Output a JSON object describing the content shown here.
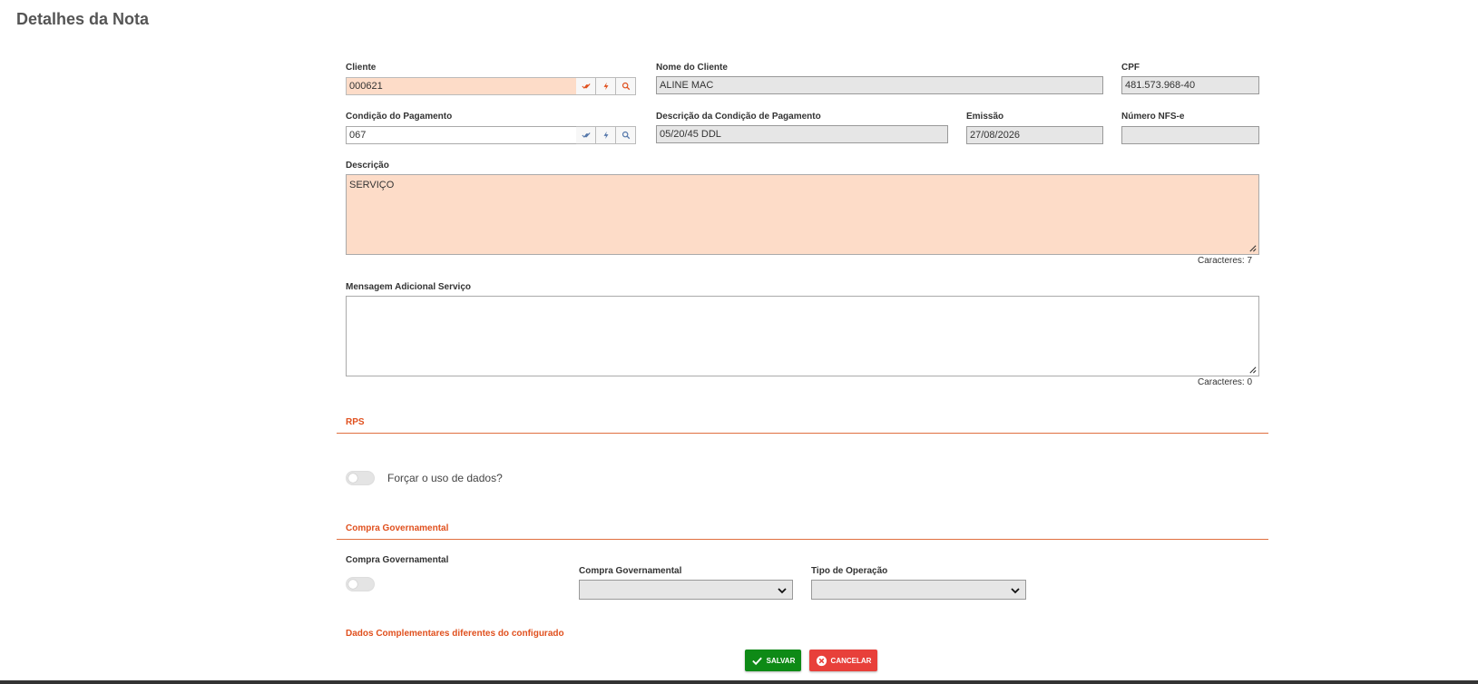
{
  "page": {
    "title": "Detalhes da Nota"
  },
  "cliente": {
    "label": "Cliente",
    "value": "000621",
    "icons": [
      "check-all-icon",
      "lightning-icon",
      "search-icon"
    ]
  },
  "nome_cliente": {
    "label": "Nome do Cliente",
    "value": "ALINE MAC"
  },
  "cpf": {
    "label": "CPF",
    "value": "481.573.968-40"
  },
  "condicao": {
    "label": "Condição do Pagamento",
    "value": "067"
  },
  "descricao_condicao": {
    "label": "Descrição da Condição de Pagamento",
    "value": "05/20/45 DDL"
  },
  "emissao": {
    "label": "Emissão",
    "value": "27/08/2026"
  },
  "numero_nfse": {
    "label": "Número NFS-e",
    "value": ""
  },
  "descricao": {
    "label": "Descrição",
    "value": "SERVIÇO",
    "counter": "Caracteres: 7"
  },
  "mensagem": {
    "label": "Mensagem Adicional Serviço",
    "value": "",
    "counter": "Caracteres: 0"
  },
  "rps": {
    "title": "RPS",
    "forcar_label": "Forçar o uso de dados?",
    "forcar_on": false
  },
  "compra_gov": {
    "title": "Compra Governamental",
    "toggle_label": "Compra Governamental",
    "toggle_on": false,
    "select_label": "Compra Governamental",
    "select_value": "",
    "tipo_label": "Tipo de Operação",
    "tipo_value": ""
  },
  "dados_complementares": {
    "title": "Dados Complementares diferentes do configurado"
  },
  "actions": {
    "save_label": "SALVAR",
    "cancel_label": "CANCELAR"
  },
  "colors": {
    "accent": "#e0501e",
    "save": "#0e8a16",
    "cancel": "#e8403a",
    "required_bg": "#fddcc8"
  }
}
